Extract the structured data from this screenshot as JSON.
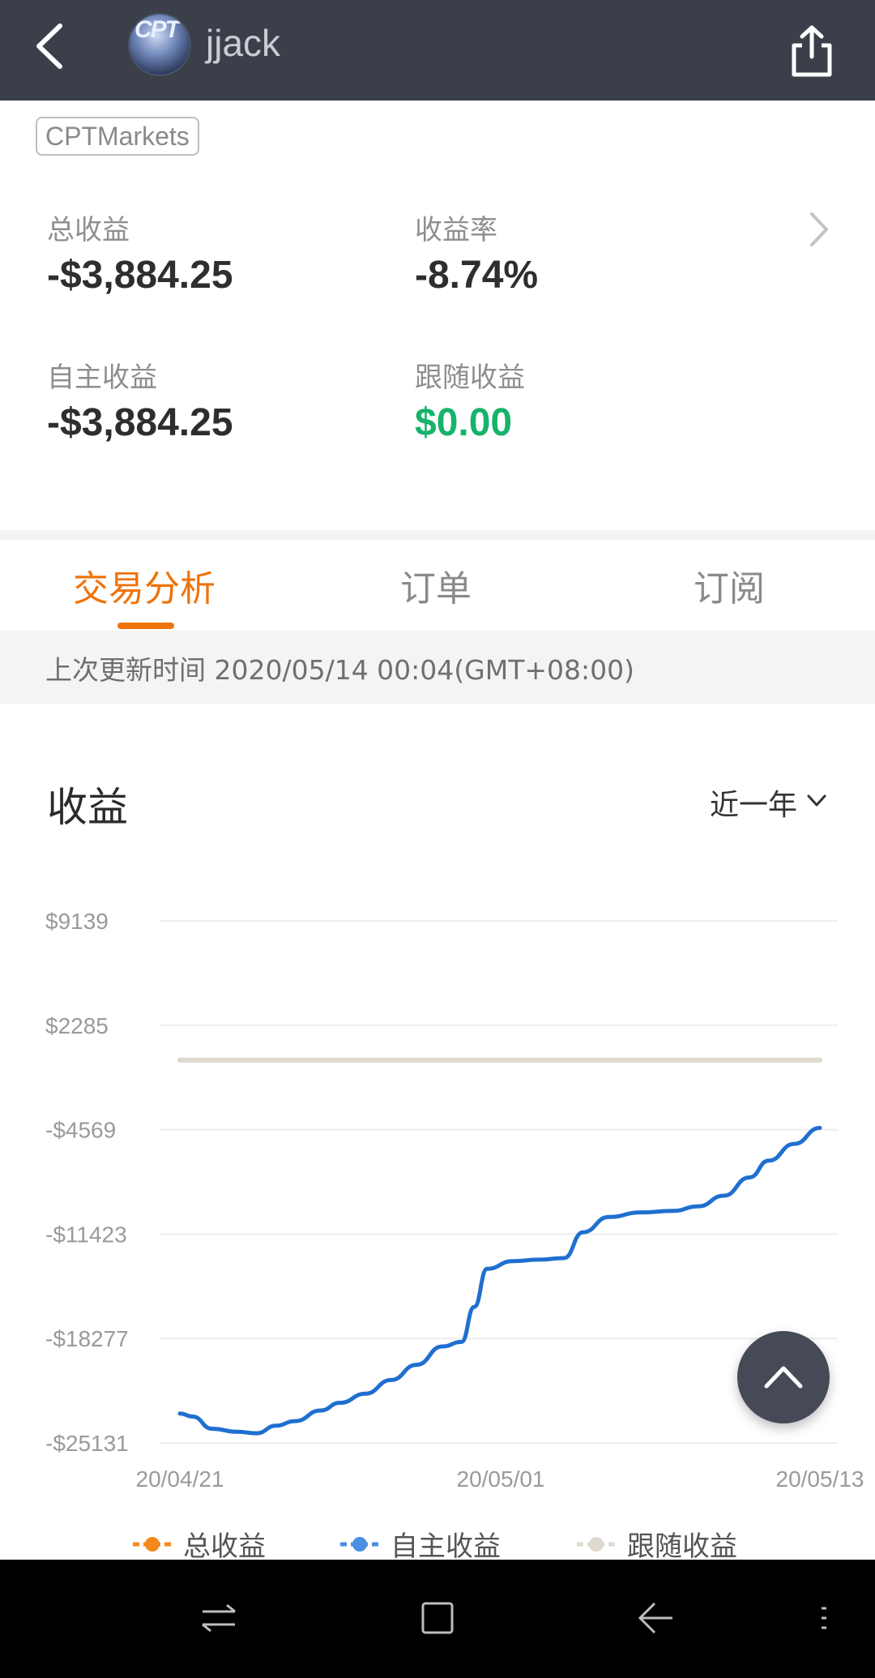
{
  "header": {
    "username": "jjack",
    "avatar_text": "CPT",
    "back_icon": "chevron-left-icon",
    "share_icon": "share-icon"
  },
  "broker_tag": "CPTMarkets",
  "stats": {
    "total_profit_label": "总收益",
    "total_profit_value": "-$3,884.25",
    "return_rate_label": "收益率",
    "return_rate_value": "-8.74%",
    "own_profit_label": "自主收益",
    "own_profit_value": "-$3,884.25",
    "follow_profit_label": "跟随收益",
    "follow_profit_value": "$0.00"
  },
  "tabs": [
    {
      "label": "交易分析",
      "active": true
    },
    {
      "label": "订单",
      "active": false
    },
    {
      "label": "订阅",
      "active": false
    }
  ],
  "update_time": "上次更新时间 2020/05/14 00:04(GMT+08:00)",
  "section": {
    "title": "收益",
    "range_label": "近一年"
  },
  "colors": {
    "accent": "#f0730b",
    "positive": "#16b36b",
    "own_series": "#1f6fd0",
    "follow_series": "#ded8cf",
    "total_series": "#f28a1c"
  },
  "chart_data": {
    "type": "line",
    "yticks": [
      "$9139",
      "$2285",
      "-$4569",
      "-$11423",
      "-$18277",
      "-$25131"
    ],
    "ylim": [
      -25131,
      9139
    ],
    "xticks": [
      "20/04/21",
      "20/05/01",
      "20/05/13"
    ],
    "grid": true,
    "legend_position": "bottom",
    "series": [
      {
        "name": "自主收益",
        "color": "#1f6fd0",
        "x": [
          0,
          0.02,
          0.05,
          0.09,
          0.12,
          0.15,
          0.18,
          0.22,
          0.25,
          0.29,
          0.33,
          0.37,
          0.41,
          0.44,
          0.46,
          0.48,
          0.52,
          0.56,
          0.6,
          0.63,
          0.67,
          0.72,
          0.77,
          0.81,
          0.85,
          0.89,
          0.92,
          0.96,
          1.0
        ],
        "y": [
          -23200,
          -23400,
          -24200,
          -24400,
          -24500,
          -24000,
          -23700,
          -23000,
          -22500,
          -21900,
          -21000,
          -20000,
          -18800,
          -18500,
          -16200,
          -13700,
          -13200,
          -13100,
          -13000,
          -11300,
          -10300,
          -10000,
          -9900,
          -9600,
          -8900,
          -7700,
          -6600,
          -5500,
          -4450
        ]
      },
      {
        "name": "跟随收益",
        "color": "#ded8cf",
        "x": [
          0,
          1.0
        ],
        "y": [
          0,
          0
        ]
      }
    ],
    "legend": [
      "总收益",
      "自主收益",
      "跟随收益"
    ]
  },
  "navbar": {
    "icons": [
      "recent-apps-icon",
      "home-icon",
      "back-icon",
      "menu-icon"
    ]
  }
}
